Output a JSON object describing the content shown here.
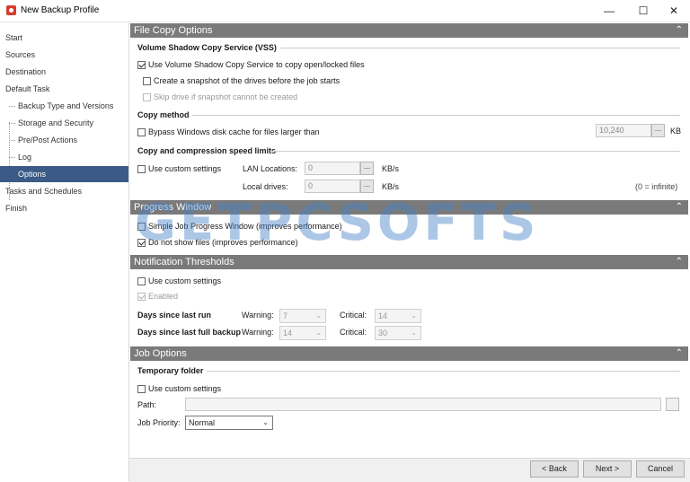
{
  "window": {
    "title": "New Backup Profile",
    "controls": {
      "minimize": "—",
      "maximize": "☐",
      "close": "✕"
    }
  },
  "sidebar": {
    "items": [
      {
        "label": "Start"
      },
      {
        "label": "Sources"
      },
      {
        "label": "Destination"
      },
      {
        "label": "Default Task"
      },
      {
        "label": "Backup Type and Versions"
      },
      {
        "label": "Storage and Security"
      },
      {
        "label": "Pre/Post Actions"
      },
      {
        "label": "Log"
      },
      {
        "label": "Options"
      },
      {
        "label": "Tasks and Schedules"
      },
      {
        "label": "Finish"
      }
    ],
    "selected": "Options"
  },
  "file_copy": {
    "header": "File Copy Options",
    "vss_group": "Volume Shadow Copy Service (VSS)",
    "vss_use": "Use Volume Shadow Copy Service to copy open/locked files",
    "vss_snapshot": "Create a snapshot of the drives before the job starts",
    "vss_skip": "Skip drive if snapshot cannot be created",
    "copy_method_group": "Copy method",
    "bypass_cache": "Bypass Windows disk cache for files larger than",
    "cache_size": "10,240",
    "cache_unit": "KB",
    "speed_group": "Copy and compression speed limits",
    "custom_settings": "Use custom settings",
    "lan_label": "LAN Locations:",
    "lan_value": "0",
    "local_label": "Local drives:",
    "local_value": "0",
    "rate_unit": "KB/s",
    "infinite_note": "(0 = infinite)",
    "browse": "..."
  },
  "progress": {
    "header": "Progress Window",
    "simple": "Simple Job Progress Window (improves performance)",
    "no_files": "Do not show files (improves performance)"
  },
  "notify": {
    "header": "Notification Thresholds",
    "custom": "Use custom settings",
    "enabled": "Enabled",
    "last_run": "Days since last run",
    "last_full": "Days since last full backup",
    "warning": "Warning:",
    "critical": "Critical:",
    "run_warning": "7",
    "run_critical": "14",
    "full_warning": "14",
    "full_critical": "30"
  },
  "job": {
    "header": "Job Options",
    "temp_group": "Temporary folder",
    "custom": "Use custom settings",
    "path_label": "Path:",
    "path_value": "",
    "priority_label": "Job Priority:",
    "priority_value": "Normal"
  },
  "footer": {
    "back": "< Back",
    "next": "Next >",
    "cancel": "Cancel"
  },
  "icons": {
    "collapse": "chevron-up-icon",
    "dropdown": "chevron-down-icon"
  },
  "watermark": "GETPCSOFTS",
  "colors": {
    "selection": "#3b5b86",
    "section_header": "#7a7a7a"
  }
}
